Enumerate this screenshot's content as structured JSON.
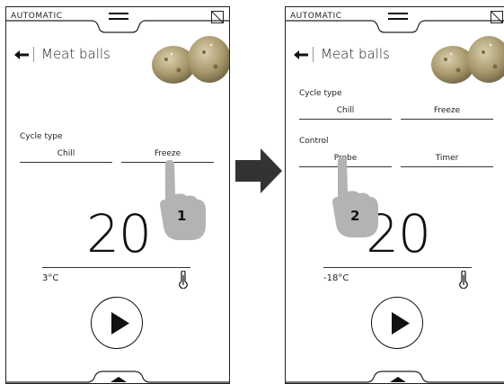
{
  "colors": {
    "hand": "#b3b3b3",
    "arrow": "#333333",
    "outline": "#222222"
  },
  "left_screen": {
    "mode": "AUTOMATIC",
    "title": "Meat balls",
    "cycle_type_label": "Cycle type",
    "cycle_options": [
      "Chill",
      "Freeze"
    ],
    "big_value": "20",
    "temperature": "3°C",
    "step_number": "1"
  },
  "right_screen": {
    "mode": "AUTOMATIC",
    "title": "Meat balls",
    "cycle_type_label": "Cycle type",
    "cycle_options": [
      "Chill",
      "Freeze"
    ],
    "control_label": "Control",
    "control_options": [
      "Probe",
      "Timer"
    ],
    "big_value": "20",
    "temperature": "-18°C",
    "step_number": "2"
  },
  "icons": {
    "menu": "menu-icon",
    "no_connection": "no-connection-icon",
    "back": "back-arrow-icon",
    "probe": "probe-icon",
    "play": "play-icon",
    "arrow": "right-arrow-icon",
    "hand": "pointing-hand-icon"
  }
}
